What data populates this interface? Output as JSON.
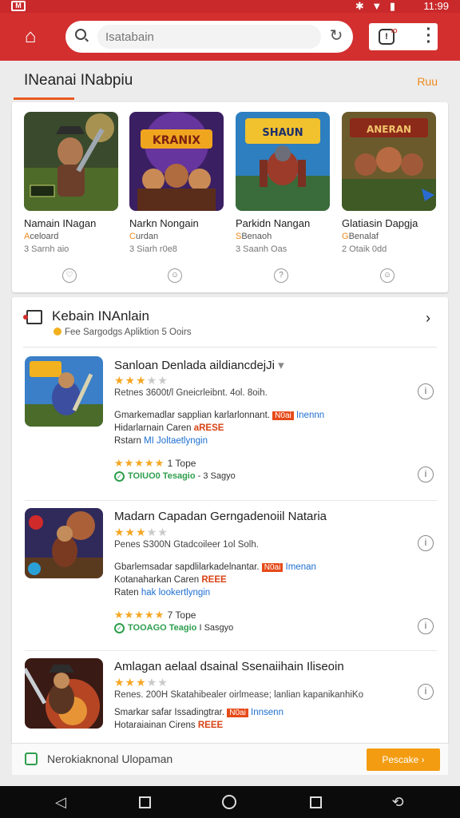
{
  "status": {
    "time": "11:99"
  },
  "search": {
    "placeholder": "Isatabain"
  },
  "top_actions": {
    "badge": "IO"
  },
  "section": {
    "title": "INeanai INabpiu",
    "link": "Ruu"
  },
  "featured": [
    {
      "name": "Namain INagan",
      "sub_mark": "A",
      "sub": "celoard",
      "meta": "3 Sarnh aio"
    },
    {
      "name": "Narkn Nongain",
      "sub_mark": "C",
      "sub": "urdan",
      "meta": "3 Siarh r0e8"
    },
    {
      "name": "Parkidn Nangan",
      "sub_mark": "S",
      "sub": "Benaoh",
      "meta": "3 Saanh Oas"
    },
    {
      "name": "Glatiasin Dapgja",
      "sub_mark": "G",
      "sub": "Benalaf",
      "meta": "2 Otaik 0dd"
    }
  ],
  "list": {
    "title": "Kebain INAnlain",
    "subtitle": "Fee Sargodgs Apliktion 5 Ooirs",
    "items": [
      {
        "title": "Sanloan Denlada aildiancdejJi",
        "stars": 3,
        "sizes": "Retnes 3600t/l Gneicrleibnt. 4ol. 8oih.",
        "desc1": "Gmarkemadlar sapplian karlarlonnant.",
        "desc1_tag": "N0ai",
        "desc1_blue": "Inennn",
        "desc2": "Hidarlarnain Caren",
        "desc2_tag": "aRESE",
        "desc3": "Rstarn",
        "desc3_blue": "MI Joltaetlyngin",
        "rating_stars": 5,
        "rating_text": "1 Tope",
        "dl_green": "TOIUO0 Tesagio",
        "dl_text": "- 3 Sagyo"
      },
      {
        "title": "Madarn Capadan Gerngadenoiil Nataria",
        "stars": 3,
        "sizes": "Penes S300N Gtadcoileer 1ol Solh.",
        "desc1": "Gbarlemsadar sapdlilarkadelnantar.",
        "desc1_tag": "N0ai",
        "desc1_blue": "Imenan",
        "desc2": "Kotanaharkan Caren",
        "desc2_tag": "REEE",
        "desc3": "Raten",
        "desc3_blue": "hak lookertlyngin",
        "rating_stars": 5,
        "rating_text": "7 Tope",
        "dl_green": "TOOAGO Teagio",
        "dl_text": "I Sasgyo"
      },
      {
        "title": "Amlagan aelaal dsainal Ssenaiihain Iliseoin",
        "stars": 3,
        "sizes": "Renes. 200H Skatahibealer oirlmease; lanlian kapanikanhiKo",
        "desc1": "Smarkar safar Issadingtrar.",
        "desc1_tag": "N0ai",
        "desc1_blue": "Innsenn",
        "desc2": "Hotaraiainan Cirens",
        "desc2_tag": "REEE"
      }
    ]
  },
  "footer": {
    "text": "Nerokiaknonal Ulopaman",
    "button": "Pescake ›"
  }
}
